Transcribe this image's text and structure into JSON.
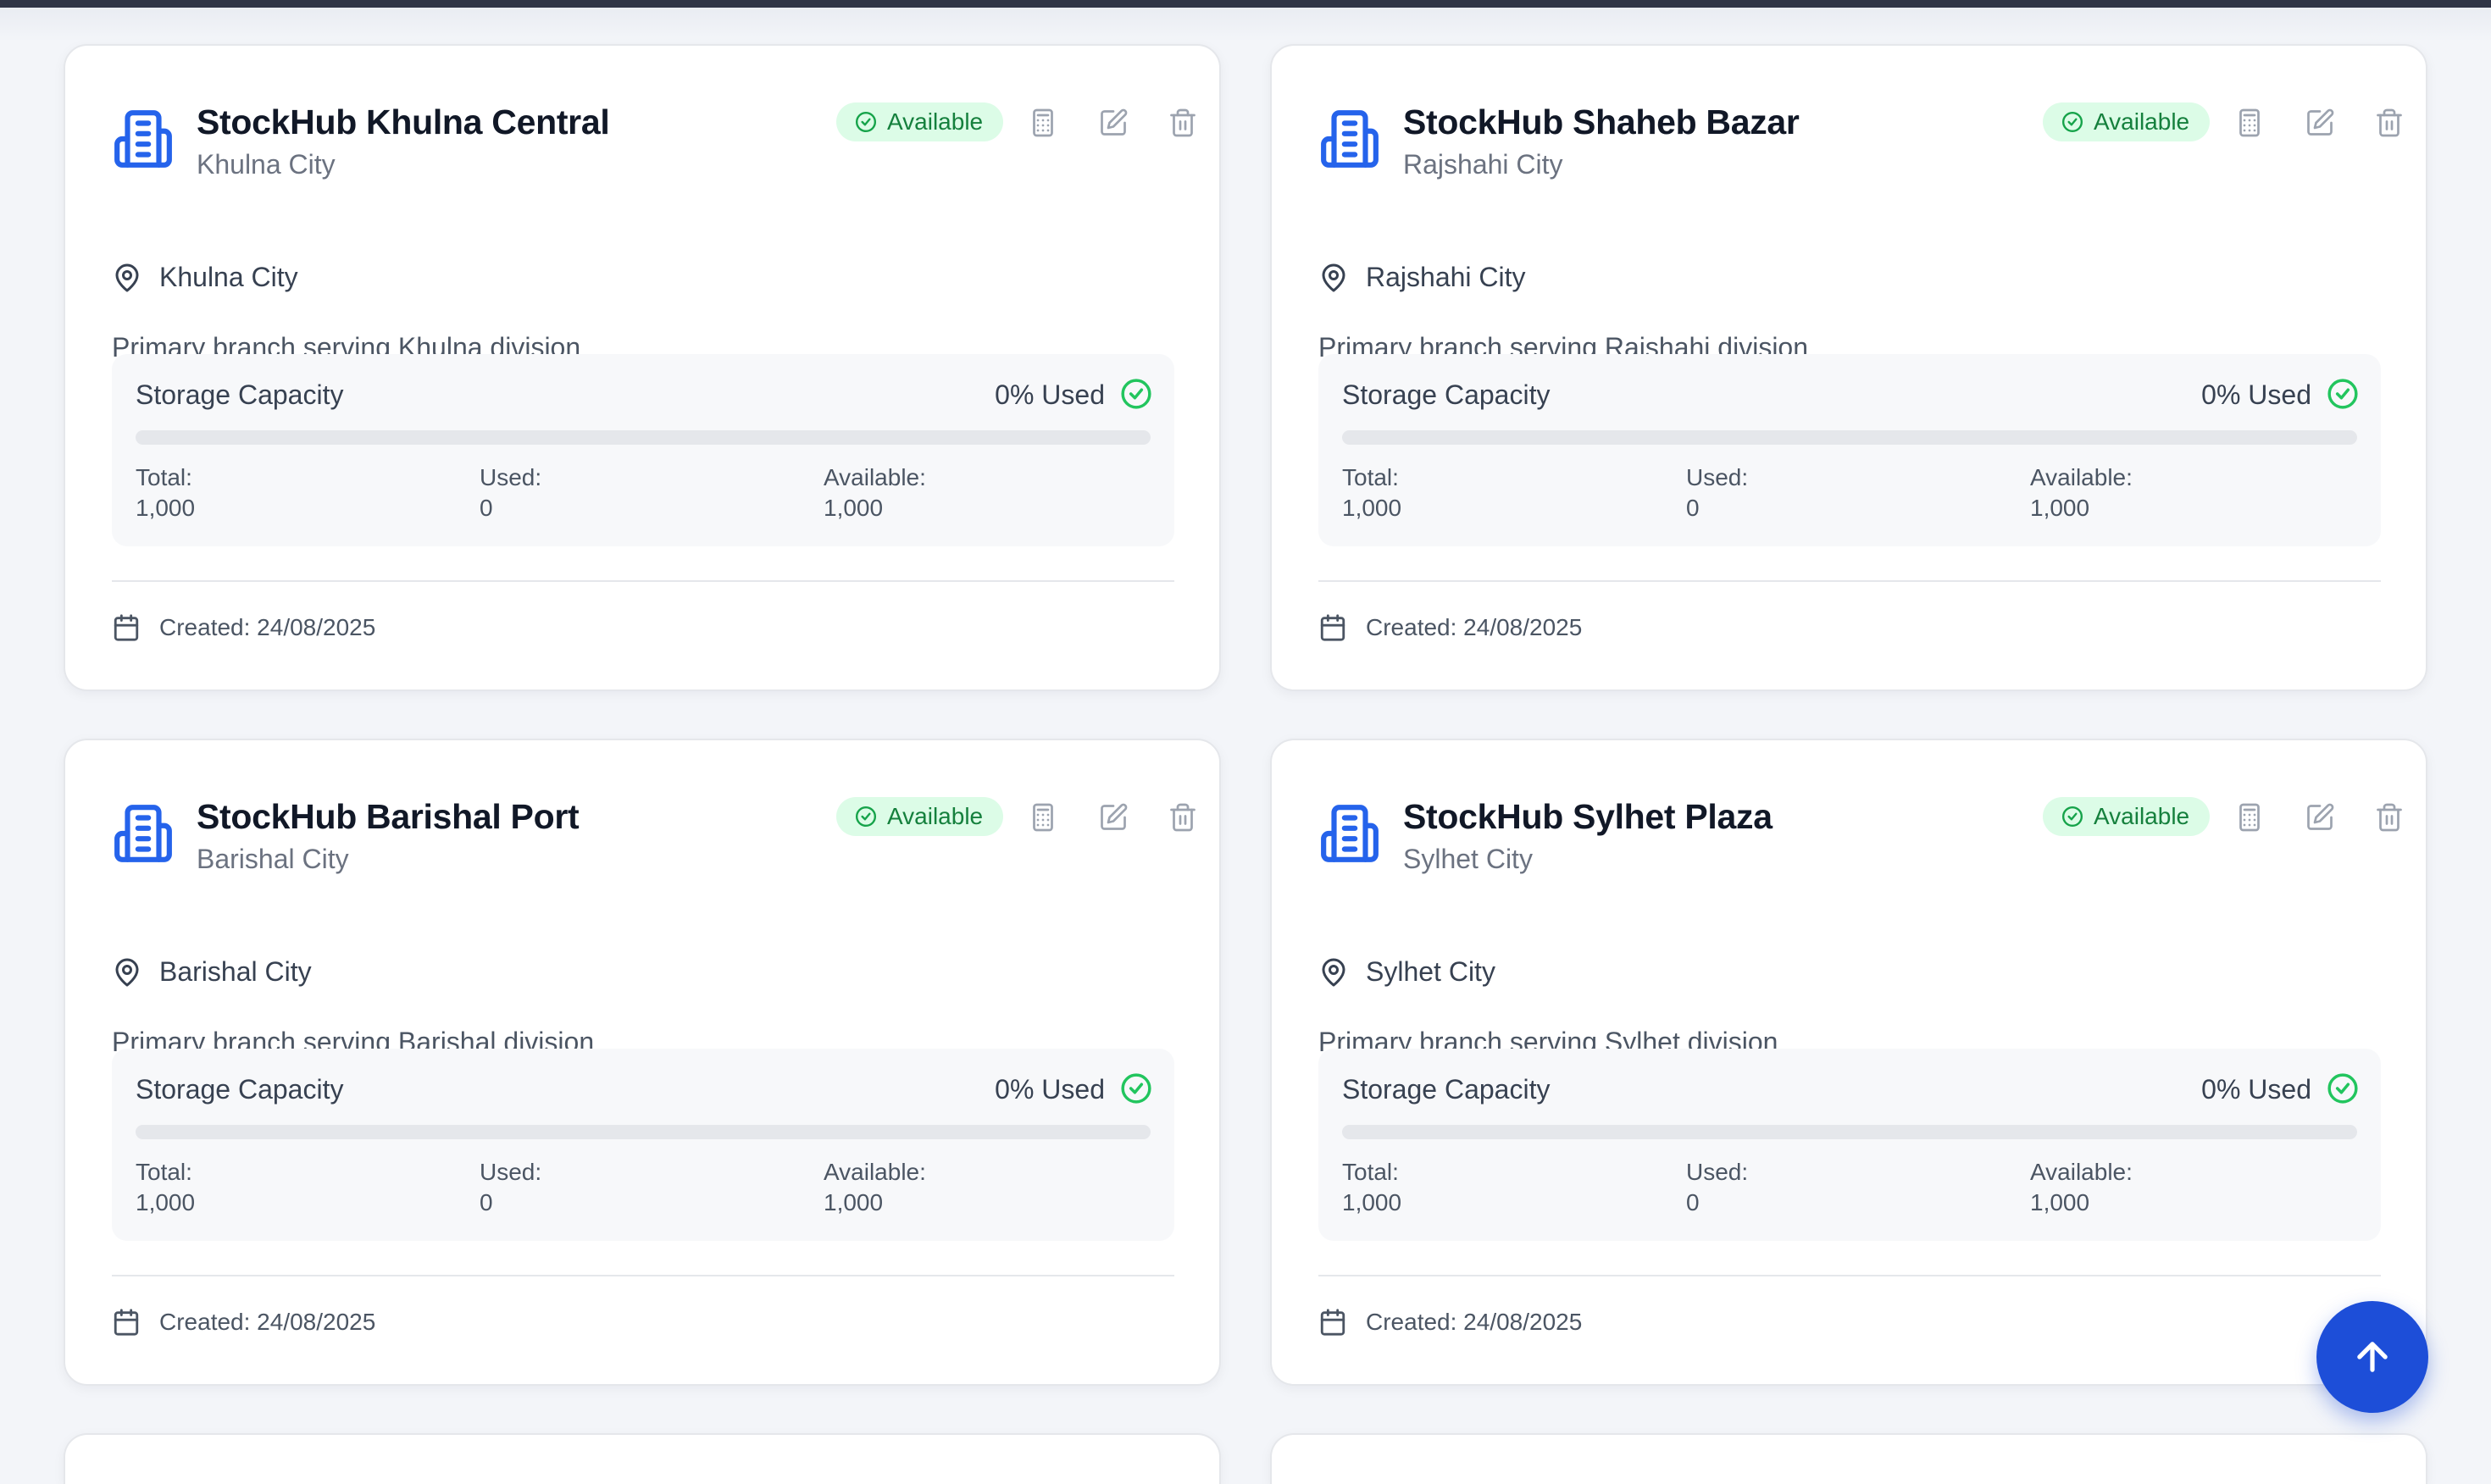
{
  "colors": {
    "accent": "#1d4ed8",
    "building_icon": "#2563eb",
    "badge_bg": "#dcfce7",
    "badge_text": "#15803d",
    "success": "#22c55e"
  },
  "cards": [
    {
      "title": "StockHub Khulna Central",
      "subtitle": "Khulna City",
      "status": "Available",
      "location": "Khulna City",
      "description": "Primary branch serving Khulna division",
      "storage_label": "Storage Capacity",
      "used_label": "0% Used",
      "used_fraction": 0,
      "total_label": "Total:",
      "total": "1,000",
      "used_key": "Used:",
      "used": "0",
      "available_label": "Available:",
      "available": "1,000",
      "created": "Created: 24/08/2025"
    },
    {
      "title": "StockHub Shaheb Bazar",
      "subtitle": "Rajshahi City",
      "status": "Available",
      "location": "Rajshahi City",
      "description": "Primary branch serving Rajshahi division",
      "storage_label": "Storage Capacity",
      "used_label": "0% Used",
      "used_fraction": 0,
      "total_label": "Total:",
      "total": "1,000",
      "used_key": "Used:",
      "used": "0",
      "available_label": "Available:",
      "available": "1,000",
      "created": "Created: 24/08/2025"
    },
    {
      "title": "StockHub Barishal Port",
      "subtitle": "Barishal City",
      "status": "Available",
      "location": "Barishal City",
      "description": "Primary branch serving Barishal division",
      "storage_label": "Storage Capacity",
      "used_label": "0% Used",
      "used_fraction": 0,
      "total_label": "Total:",
      "total": "1,000",
      "used_key": "Used:",
      "used": "0",
      "available_label": "Available:",
      "available": "1,000",
      "created": "Created: 24/08/2025"
    },
    {
      "title": "StockHub Sylhet Plaza",
      "subtitle": "Sylhet City",
      "status": "Available",
      "location": "Sylhet City",
      "description": "Primary branch serving Sylhet division",
      "storage_label": "Storage Capacity",
      "used_label": "0% Used",
      "used_fraction": 0,
      "total_label": "Total:",
      "total": "1,000",
      "used_key": "Used:",
      "used": "0",
      "available_label": "Available:",
      "available": "1,000",
      "created": "Created: 24/08/2025"
    }
  ],
  "icons": {
    "building": "building-icon",
    "status": "check-circle-icon",
    "calculator": "calculator-icon",
    "edit": "edit-icon",
    "delete": "trash-icon",
    "location": "map-pin-icon",
    "used_ok": "check-circle-icon",
    "calendar": "calendar-icon",
    "scroll_top": "arrow-up-icon"
  }
}
